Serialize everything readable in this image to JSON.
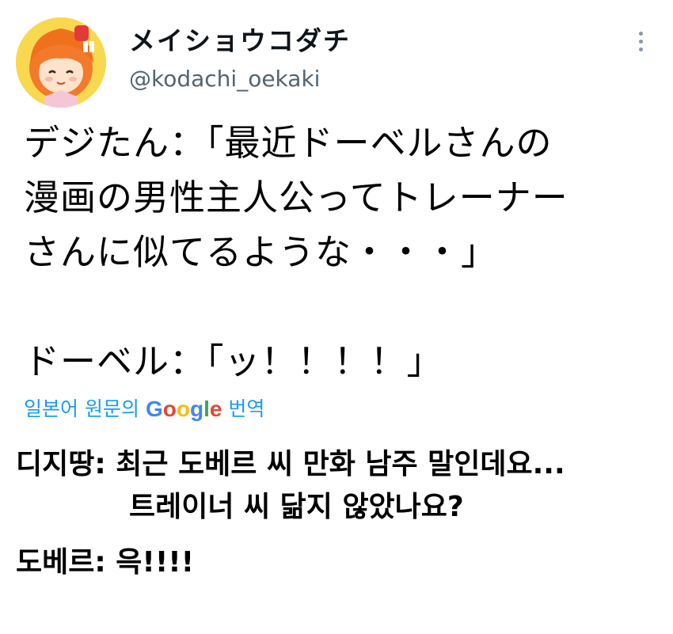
{
  "author": {
    "display_name": "メイショウコダチ",
    "handle": "@kodachi_oekaki",
    "avatar_icon": "anime-avatar-icon",
    "avatar_bg": "#f7d44c"
  },
  "menu": {
    "more_icon": "more-vertical-icon"
  },
  "tweet": {
    "lines": [
      "デジたん：「最近ドーベルさんの",
      "漫画の男性主人公ってトレーナー",
      "さんに似てるような・・・」",
      "ドーベル：「ッ！！！！」"
    ]
  },
  "translate": {
    "prefix": "일본어 원문의",
    "google": [
      "G",
      "o",
      "o",
      "g",
      "l",
      "e"
    ],
    "suffix": "번역",
    "accent": "#1d9bf0"
  },
  "translation": {
    "line1": "디지땅: 최근 도베르 씨 만화 남주 말인데요...",
    "line2": "트레이너 씨 닮지 않았나요?",
    "line3": "도베르: 윽!!!!"
  }
}
